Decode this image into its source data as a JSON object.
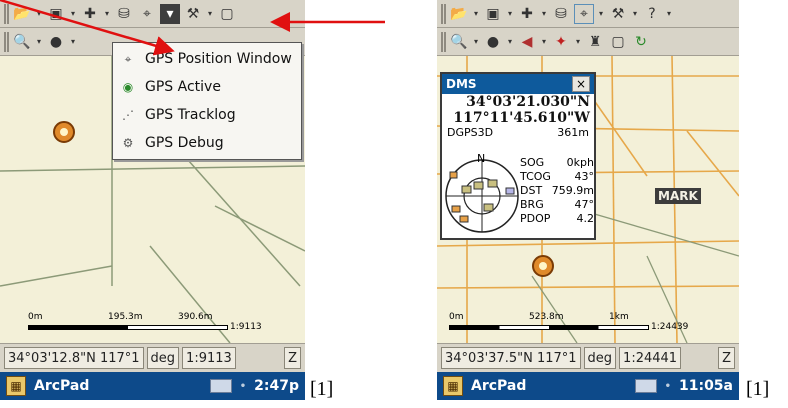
{
  "left": {
    "menu": [
      {
        "label": "GPS Position Window",
        "icon": "gps-position-window-icon"
      },
      {
        "label": "GPS Active",
        "icon": "gps-active-icon"
      },
      {
        "label": "GPS Tracklog",
        "icon": "gps-tracklog-icon"
      },
      {
        "label": "GPS Debug",
        "icon": "gps-debug-icon"
      }
    ],
    "scale": {
      "tick0": "0m",
      "tick1": "195.3m",
      "tick2": "390.6m",
      "ratio": "1:9113"
    },
    "status": {
      "coords": "34°03'12.8\"N 117°1",
      "unit": "deg",
      "scale": "1:9113",
      "z": "Z"
    },
    "taskbar": {
      "app": "ArcPad",
      "time": "2:47p"
    },
    "ref": "[1]"
  },
  "right": {
    "gps": {
      "title": "DMS",
      "close": "×",
      "lat": "34°03'21.030\"N",
      "lon": "117°11'45.610\"W",
      "fix": "DGPS3D",
      "alt": "361m",
      "sky_north": "N",
      "readouts": [
        {
          "label": "SOG",
          "value": "0kph"
        },
        {
          "label": "TCOG",
          "value": "43°"
        },
        {
          "label": "DST",
          "value": "759.9m"
        },
        {
          "label": "BRG",
          "value": "47°"
        },
        {
          "label": "PDOP",
          "value": "4.2"
        }
      ]
    },
    "mark": "MARK",
    "scale": {
      "tick0": "0m",
      "tick1": "523.8m",
      "tick2": "1km",
      "ratio": "1:24439"
    },
    "status": {
      "coords": "34°03'37.5\"N 117°1",
      "unit": "deg",
      "scale": "1:24441",
      "z": "Z"
    },
    "taskbar": {
      "app": "ArcPad",
      "time": "11:05a"
    },
    "ref": "[1]"
  },
  "colors": {
    "taskbar": "#0d4a8a",
    "titlebar": "#0e5a9c",
    "roads": "#e6a84a",
    "arrow": "#e01010",
    "map_bg": "#f3f0d8"
  }
}
